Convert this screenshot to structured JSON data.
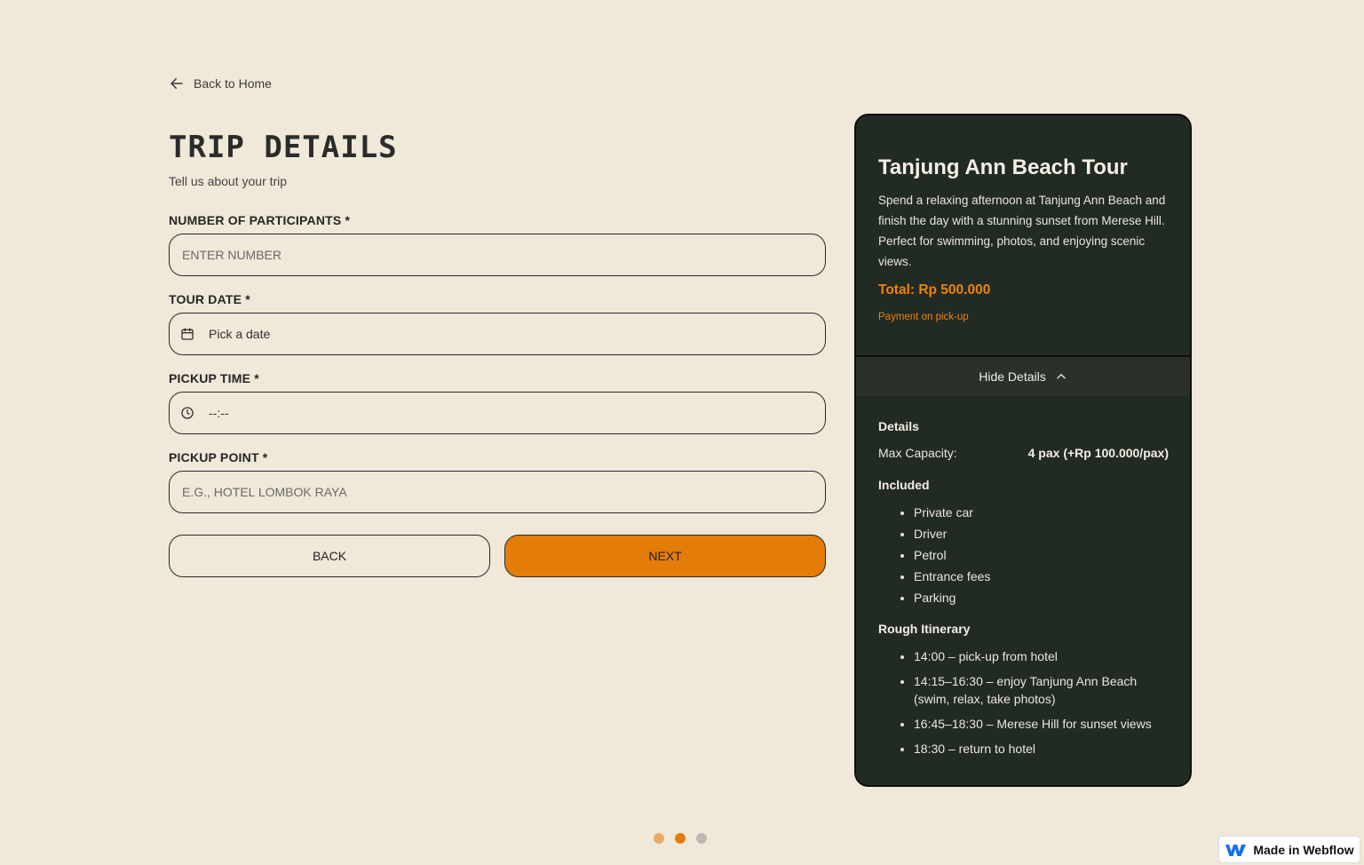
{
  "nav": {
    "back_home_label": "Back to Home",
    "back_icon": "arrow-left-icon"
  },
  "form": {
    "title": "TRIP DETAILS",
    "subtitle": "Tell us about your trip",
    "participants": {
      "label": "NUMBER OF PARTICIPANTS *",
      "placeholder": "ENTER NUMBER"
    },
    "tour_date": {
      "label": "TOUR DATE *",
      "value": "Pick a date",
      "icon": "calendar-icon"
    },
    "pickup_time": {
      "label": "PICKUP TIME *",
      "value": "--:--",
      "icon": "clock-icon"
    },
    "pickup_point": {
      "label": "PICKUP POINT *",
      "placeholder": "E.G., HOTEL LOMBOK RAYA"
    },
    "back_label": "BACK",
    "next_label": "NEXT"
  },
  "tour": {
    "title": "Tanjung Ann Beach Tour",
    "description": "Spend a relaxing afternoon at Tanjung Ann Beach and finish the day with a stunning sunset from Merese Hill. Perfect for swimming, photos, and enjoying scenic views.",
    "total": "Total: Rp 500.000",
    "payment_note": "Payment on pick-up",
    "toggle_label": "Hide Details",
    "toggle_icon": "chevron-up-icon",
    "details_heading": "Details",
    "max_capacity_label": "Max Capacity:",
    "max_capacity_value": "4 pax (+Rp 100.000/pax)",
    "included_heading": "Included",
    "included": [
      "Private car",
      "Driver",
      "Petrol",
      "Entrance fees",
      "Parking"
    ],
    "itinerary_heading": "Rough Itinerary",
    "itinerary": [
      "14:00 – pick-up from hotel",
      "14:15–16:30 – enjoy Tanjung Ann Beach (swim, relax, take photos)",
      "16:45–18:30 – Merese Hill for sunset views",
      "18:30 – return to hotel"
    ]
  },
  "steps": {
    "total": 3,
    "current": 2
  },
  "badge": {
    "label": "Made in Webflow",
    "icon": "webflow-logo-icon"
  },
  "colors": {
    "background": "#f0e8d8",
    "accent": "#e37c08",
    "card": "#222a24",
    "dot_done": "#eba96a",
    "dot_active": "#e37c08",
    "dot_pending": "#bdb9b2"
  }
}
